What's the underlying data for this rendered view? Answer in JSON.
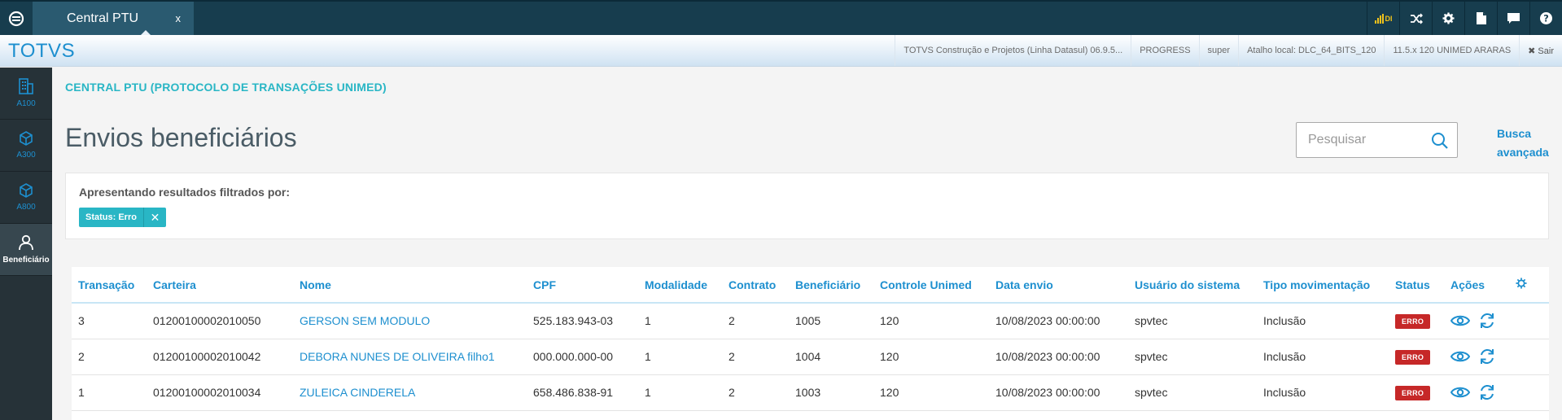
{
  "topbar": {
    "tab_label": "Central PTU",
    "tab_close": "x",
    "signal_label": "DI"
  },
  "brandbar": {
    "brand": "TOTVS",
    "infos": [
      "TOTVS Construção e Projetos (Linha Datasul) 06.9.5...",
      "PROGRESS",
      "super",
      "Atalho local: DLC_64_BITS_120",
      "11.5.x 120 UNIMED ARARAS"
    ],
    "exit_label": "✖ Sair"
  },
  "sidebar": {
    "items": [
      {
        "label": "A100",
        "icon": "building-icon"
      },
      {
        "label": "A300",
        "icon": "cube-icon"
      },
      {
        "label": "A800",
        "icon": "cube-icon"
      },
      {
        "label": "Beneficiário",
        "icon": "user-icon"
      }
    ]
  },
  "page": {
    "breadcrumb": "CENTRAL PTU (PROTOCOLO DE TRANSAÇÕES UNIMED)",
    "title": "Envios beneficiários",
    "search_placeholder": "Pesquisar",
    "advanced_search": "Busca avançada"
  },
  "filter": {
    "title": "Apresentando resultados filtrados por:",
    "chip_label": "Status: Erro",
    "chip_remove": "✕"
  },
  "table": {
    "columns": [
      "Transação",
      "Carteira",
      "Nome",
      "CPF",
      "Modalidade",
      "Contrato",
      "Beneficiário",
      "Controle Unimed",
      "Data envio",
      "Usuário do sistema",
      "Tipo movimentação",
      "Status",
      "Ações"
    ],
    "rows": [
      {
        "transacao": "3",
        "carteira": "01200100002010050",
        "nome": "GERSON SEM MODULO",
        "cpf": "525.183.943-03",
        "modalidade": "1",
        "contrato": "2",
        "beneficiario": "1005",
        "controle": "120",
        "data_envio": "10/08/2023 00:00:00",
        "usuario": "spvtec",
        "tipo": "Inclusão",
        "status": "ERRO"
      },
      {
        "transacao": "2",
        "carteira": "01200100002010042",
        "nome": "DEBORA NUNES DE OLIVEIRA filho1",
        "cpf": "000.000.000-00",
        "modalidade": "1",
        "contrato": "2",
        "beneficiario": "1004",
        "controle": "120",
        "data_envio": "10/08/2023 00:00:00",
        "usuario": "spvtec",
        "tipo": "Inclusão",
        "status": "ERRO"
      },
      {
        "transacao": "1",
        "carteira": "01200100002010034",
        "nome": "ZULEICA CINDERELA",
        "cpf": "658.486.838-91",
        "modalidade": "1",
        "contrato": "2",
        "beneficiario": "1003",
        "controle": "120",
        "data_envio": "10/08/2023 00:00:00",
        "usuario": "spvtec",
        "tipo": "Inclusão",
        "status": "ERRO"
      }
    ]
  },
  "colors": {
    "topbar": "#173d4e",
    "accent": "#1d8fcf",
    "teal": "#29b6c5",
    "error": "#c62828",
    "sidebar": "#263238"
  }
}
